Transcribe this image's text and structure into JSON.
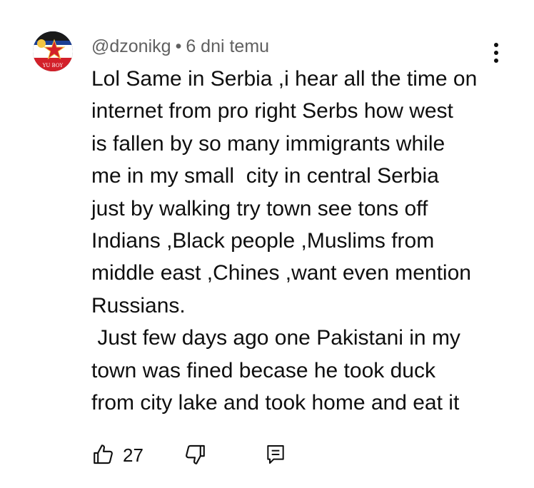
{
  "comment": {
    "author": "@dzonikg",
    "separator": "•",
    "timestamp": "6 dni temu",
    "avatar_text": "YU BOY",
    "lines": [
      "Lol Same in Serbia ,i hear all the time on",
      "internet from pro right Serbs how west",
      "is fallen by so many immigrants while",
      "me in my small  city in central Serbia",
      "just by walking try town see tons off",
      "Indians ,Black people ,Muslims from",
      "middle east ,Chines ,want even mention",
      "Russians.",
      " Just few days ago one Pakistani in my",
      "town was fined becase he took duck",
      "from city lake and took home and eat it"
    ],
    "like_count": "27"
  },
  "icons": {
    "avatar": "avatar-yugoslav-flag",
    "menu": "more-vert-icon",
    "like": "thumb-up-icon",
    "dislike": "thumb-down-icon",
    "reply": "reply-comment-icon"
  },
  "colors": {
    "text": "#0f0f0f",
    "secondary": "#606060",
    "background": "#ffffff",
    "avatar_red": "#d3202a",
    "avatar_blue": "#1c3f94"
  }
}
